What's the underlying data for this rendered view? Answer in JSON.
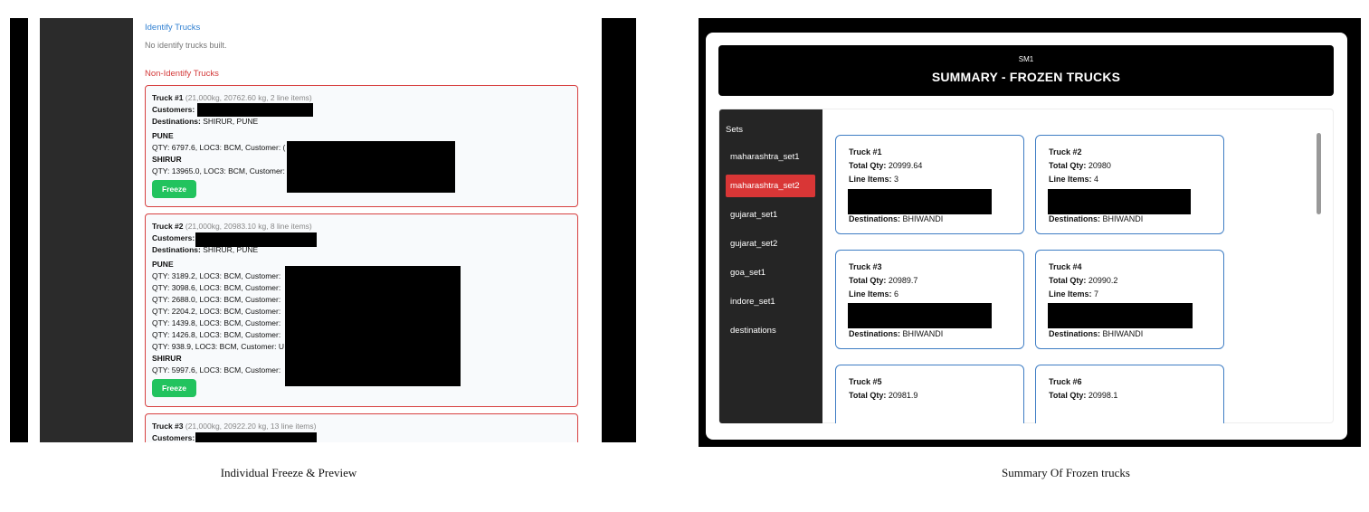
{
  "left": {
    "identify_title": "Identify Trucks",
    "identify_note": "No identify trucks built.",
    "non_identify_title": "Non-Identify Trucks",
    "labels": {
      "customers": "Customers:",
      "destinations": "Destinations:",
      "freeze": "Freeze"
    },
    "trucks": [
      {
        "title": "Truck #1",
        "meta": "(21,000kg, 20762.60 kg, 2 line items)",
        "destinations": "SHIRUR, PUNE",
        "groups": [
          {
            "location": "PUNE",
            "lines": [
              "QTY: 6797.6, LOC3: BCM, Customer: ("
            ]
          },
          {
            "location": "SHIRUR",
            "lines": [
              "QTY: 13965.0, LOC3: BCM, Customer:"
            ]
          }
        ]
      },
      {
        "title": "Truck #2",
        "meta": "(21,000kg, 20983.10 kg, 8 line items)",
        "destinations": "SHIRUR, PUNE",
        "groups": [
          {
            "location": "PUNE",
            "lines": [
              "QTY: 3189.2, LOC3: BCM, Customer:",
              "QTY: 3098.6, LOC3: BCM, Customer:",
              "QTY: 2688.0, LOC3: BCM, Customer:",
              "QTY: 2204.2, LOC3: BCM, Customer:",
              "QTY: 1439.8, LOC3: BCM, Customer:",
              "QTY: 1426.8, LOC3: BCM, Customer:",
              "QTY: 938.9, LOC3: BCM, Customer: U"
            ]
          },
          {
            "location": "SHIRUR",
            "lines": [
              "QTY: 5997.6, LOC3: BCM, Customer:"
            ]
          }
        ]
      },
      {
        "title": "Truck #3",
        "meta": "(21,000kg, 20922.20 kg, 13 line items)",
        "destinations": "",
        "groups": []
      }
    ],
    "caption": "Individual Freeze & Preview"
  },
  "right": {
    "header_sub": "SM1",
    "header_title": "SUMMARY - FROZEN TRUCKS",
    "sets_label": "Sets",
    "sets": [
      "maharashtra_set1",
      "maharashtra_set2",
      "gujarat_set1",
      "gujarat_set2",
      "goa_set1",
      "indore_set1",
      "destinations"
    ],
    "active_set": "maharashtra_set2",
    "card_labels": {
      "total_qty": "Total Qty:",
      "line_items": "Line Items:",
      "destinations": "Destinations:"
    },
    "cards": [
      {
        "title": "Truck #1",
        "total_qty": "20999.64",
        "line_items": "3",
        "destinations": "BHIWANDI"
      },
      {
        "title": "Truck #2",
        "total_qty": "20980",
        "line_items": "4",
        "destinations": "BHIWANDI"
      },
      {
        "title": "Truck #3",
        "total_qty": "20989.7",
        "line_items": "6",
        "destinations": "BHIWANDI"
      },
      {
        "title": "Truck #4",
        "total_qty": "20990.2",
        "line_items": "7",
        "destinations": "BHIWANDI"
      },
      {
        "title": "Truck #5",
        "total_qty": "20981.9"
      },
      {
        "title": "Truck #6",
        "total_qty": "20998.1"
      }
    ],
    "caption": "Summary Of Frozen trucks"
  },
  "colors": {
    "accent_red": "#d93636",
    "freeze_green": "#22c35e",
    "card_blue": "#3e7dc4",
    "link_blue": "#2f7fd1"
  }
}
